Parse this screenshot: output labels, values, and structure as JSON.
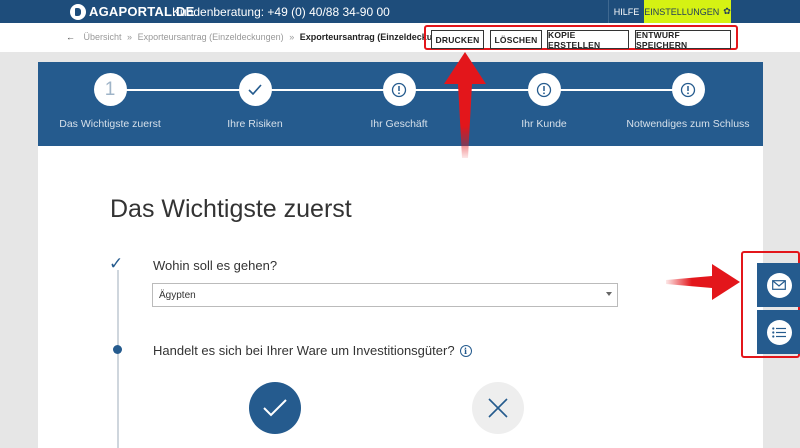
{
  "header": {
    "logo": "AGAPORTAL.DE",
    "hotline": "Kundenberatung: +49 (0) 40/88 34-90 00",
    "help": "HILFE",
    "settings": "EINSTELLUNGEN"
  },
  "breadcrumb": {
    "back_icon": "←",
    "items": [
      "Übersicht",
      "Exporteursantrag (Einzeldeckungen)",
      "Exporteursantrag (Einzeldeckungen)"
    ],
    "separator": "»"
  },
  "actions": [
    "DRUCKEN",
    "LÖSCHEN",
    "KOPIE ERSTELLEN",
    "ENTWURF SPEICHERN"
  ],
  "steps": [
    {
      "label": "Das Wichtigste zuerst",
      "marker": "1",
      "icon": "number"
    },
    {
      "label": "Ihre Risiken",
      "icon": "check-icon"
    },
    {
      "label": "Ihr Geschäft",
      "icon": "alert-icon"
    },
    {
      "label": "Ihr Kunde",
      "icon": "alert-icon"
    },
    {
      "label": "Notwendiges zum Schluss",
      "icon": "alert-icon"
    }
  ],
  "main": {
    "title": "Das Wichtigste zuerst",
    "q1": {
      "label": "Wohin soll es gehen?",
      "value": "Ägypten"
    },
    "q2": {
      "label": "Handelt es sich bei Ihrer Ware um Investitionsgüter?",
      "info": "i"
    }
  },
  "side_buttons": [
    "mail-icon",
    "list-icon"
  ],
  "colors": {
    "brand": "#1e4d7b",
    "accent": "#d5f213",
    "steps_bg": "#255b8e",
    "highlight": "#e3161b"
  }
}
